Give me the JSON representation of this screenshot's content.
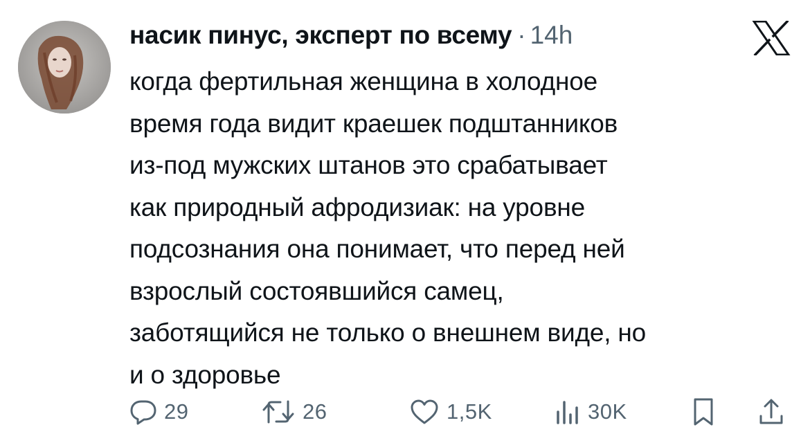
{
  "tweet": {
    "author": "насик пинус, эксперт по всему",
    "separator": "·",
    "time": "14h",
    "lines": [
      "когда фертильная женщина в холодное",
      "время года видит краешек подштанников",
      "из-под мужских штанов это срабатывает",
      "как природный афродизиак: на уровне",
      "подсознания она понимает, что перед ней",
      "взрослый состоявшийся самец,",
      "заботящийся не только о внешнем виде, но",
      "и о здоровье"
    ]
  },
  "actions": {
    "replies": "29",
    "reposts": "26",
    "likes": "1,5K",
    "views": "30K"
  },
  "icons": {
    "brand": "x-logo-icon",
    "reply": "reply-bubble-icon",
    "repost": "repost-arrows-icon",
    "like": "heart-icon",
    "views": "bar-chart-icon",
    "bookmark": "bookmark-icon",
    "share": "share-upload-icon"
  },
  "colors": {
    "text": "#0f1419",
    "secondary": "#536471",
    "background": "#ffffff"
  }
}
